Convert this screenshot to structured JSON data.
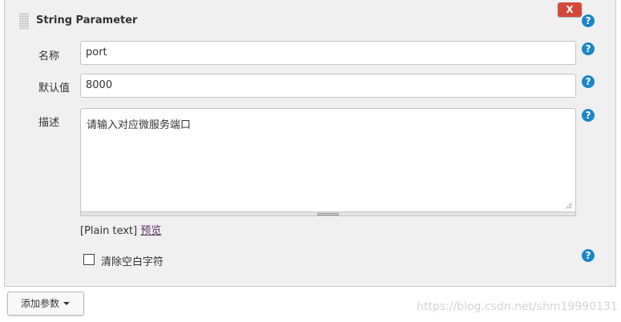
{
  "parameter": {
    "title": "String Parameter",
    "delete_label": "X",
    "help_symbol": "?",
    "name_label": "名称",
    "name_value": "port",
    "default_label": "默认值",
    "default_value": "8000",
    "description_label": "描述",
    "description_value": "请输入对应微服务端口",
    "format_text": "[Plain text]",
    "preview_link": "预览",
    "trim_label": "清除空白字符",
    "trim_checked": false
  },
  "footer": {
    "add_param_label": "添加参数"
  },
  "watermark": "https://blog.csdn.net/shm19990131",
  "colors": {
    "panel_bg": "#f0f0f0",
    "delete_button": "#d24939",
    "help_icon": "#1b86c9",
    "link": "#5c3566"
  }
}
